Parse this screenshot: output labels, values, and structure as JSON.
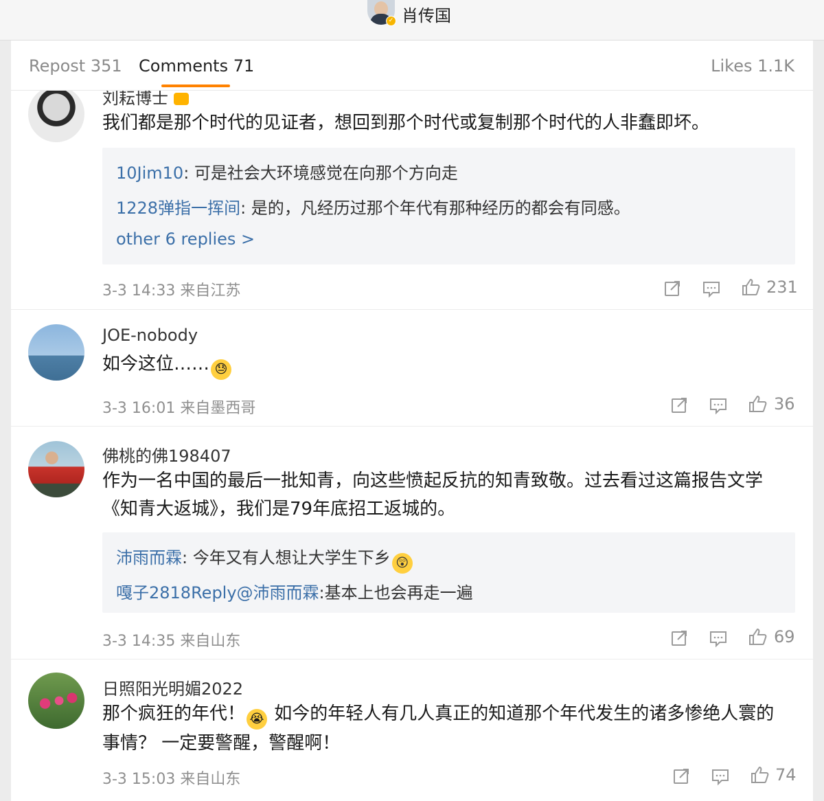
{
  "header": {
    "title": "肖传国"
  },
  "tabs": {
    "repost": "Repost 351",
    "comments": "Comments 71",
    "likes": "Likes 1.1K"
  },
  "comments": [
    {
      "username": "刘耘博士",
      "text": "我们都是那个时代的见证者，想回到那个时代或复制那个时代的人非蠢即坏。",
      "replies": [
        {
          "name": "10Jim10",
          "sep": ": ",
          "text": "可是社会大环境感觉在向那个方向走"
        },
        {
          "name": "1228弹指一挥间",
          "sep": ": ",
          "text": "是的，凡经历过那个年代有那种经历的都会有同感。"
        }
      ],
      "more_replies": "other 6 replies >",
      "time": "3-3 14:33 来自江苏",
      "likes": "231"
    },
    {
      "username": "JOE-nobody",
      "text": "如今这位……",
      "time": "3-3 16:01 来自墨西哥",
      "likes": "36"
    },
    {
      "username": "佛桃的佛198407",
      "text": "作为一名中国的最后一批知青，向这些愤起反抗的知青致敬。过去看过这篇报告文学《知青大返城》，我们是79年底招工返城的。",
      "replies": [
        {
          "name": "沛雨而霖",
          "sep": ": ",
          "text": "今年又有人想让大学生下乡"
        },
        {
          "name": "嘎子2818",
          "mid": "Reply",
          "at": "@沛雨而霖",
          "sep": ":",
          "text": "基本上也会再走一遍"
        }
      ],
      "time": "3-3 14:35 来自山东",
      "likes": "69"
    },
    {
      "username": "日照阳光明媚2022",
      "text_part1": "那个疯狂的年代！",
      "text_part2": " 如今的年轻人有几人真正的知道那个年代发生的诸多惨绝人寰的 事情？ 一定要警醒，警醒啊！",
      "time": "3-3 15:03 来自山东",
      "likes": "74"
    }
  ],
  "icons": {
    "share": "share-icon",
    "comment": "comment-icon",
    "like": "thumbs-up-icon",
    "emoji_sweat": "sweat-emoji-icon",
    "emoji_shock": "shocked-emoji-icon",
    "emoji_cry": "crying-emoji-icon",
    "badge": "crown-badge-icon"
  },
  "colors": {
    "accent": "#ff8200",
    "link": "#3b6fa8",
    "muted": "#8f8f8f",
    "reply_bg": "#f4f5f7"
  }
}
